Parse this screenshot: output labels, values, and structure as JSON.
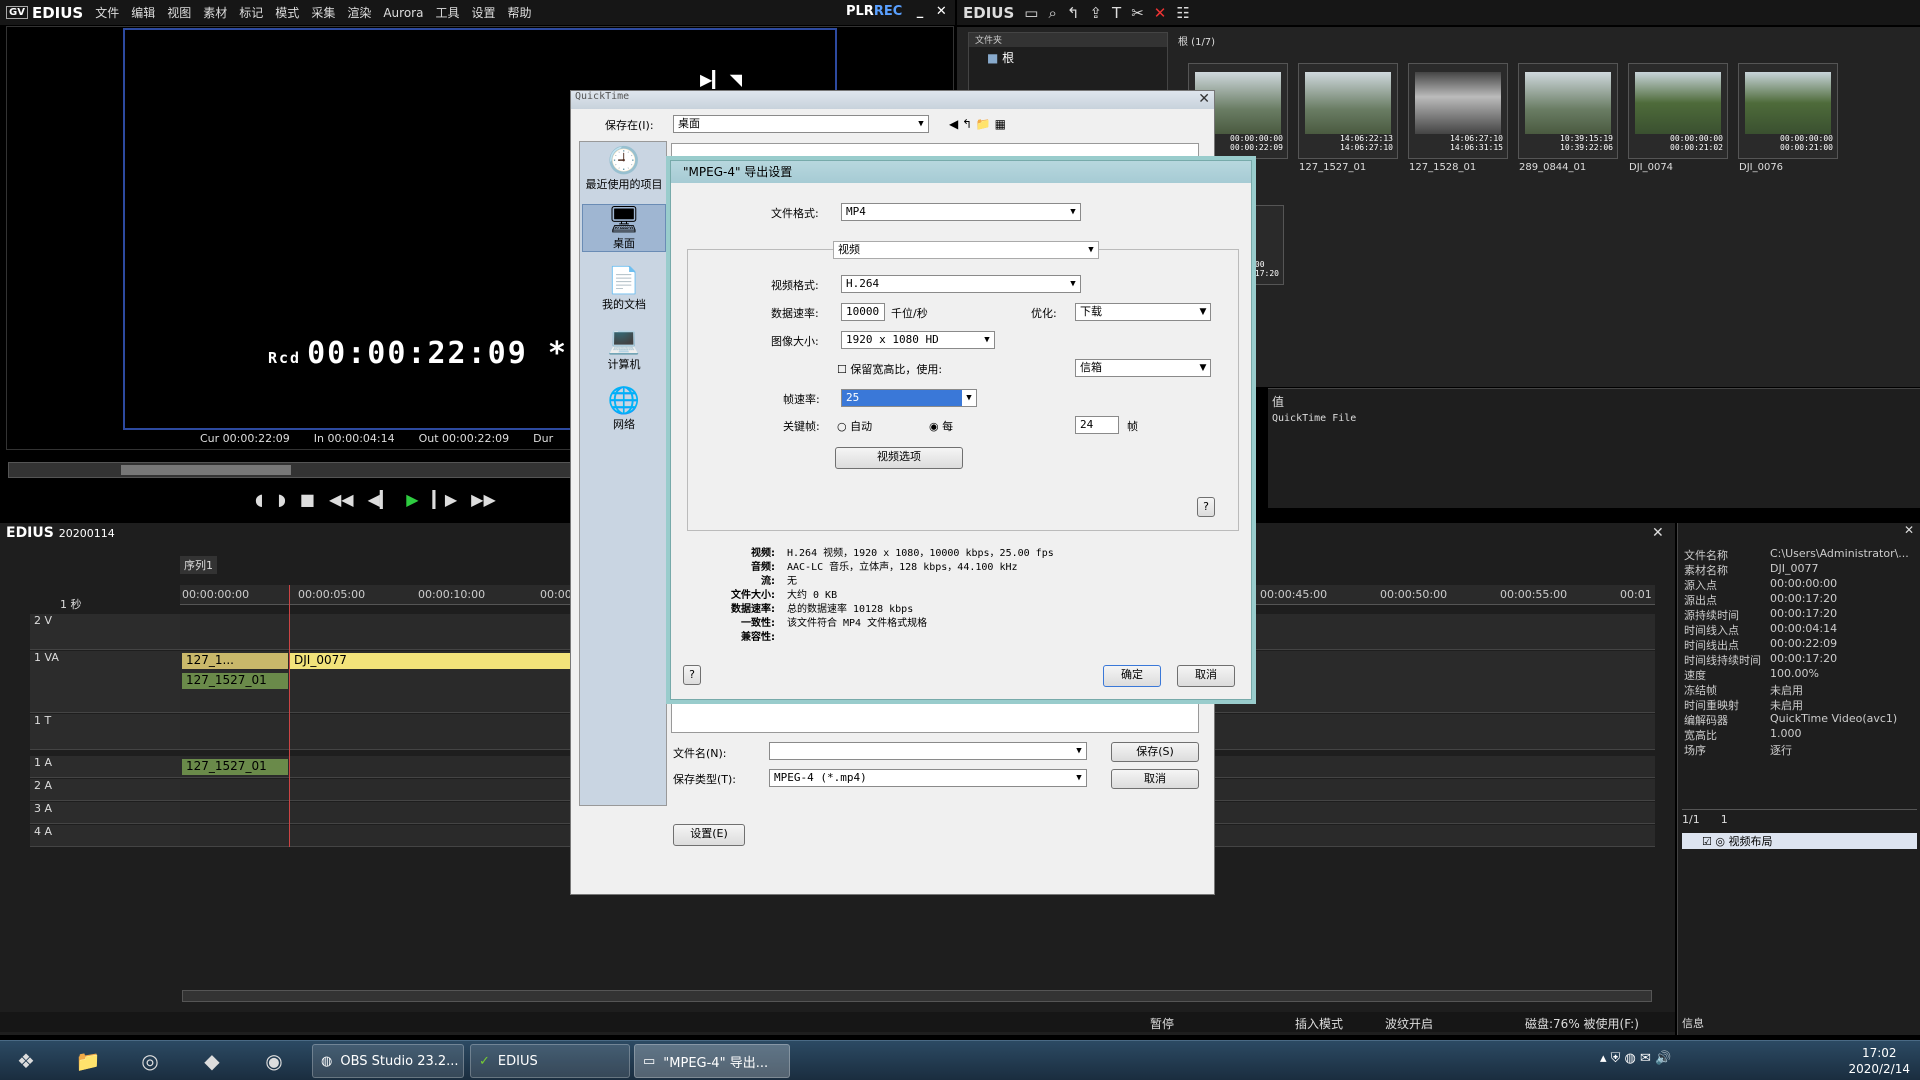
{
  "app": {
    "name": "EDIUS",
    "menu": [
      "文件",
      "编辑",
      "视图",
      "素材",
      "标记",
      "模式",
      "采集",
      "渲染",
      "Aurora",
      "工具",
      "设置",
      "帮助"
    ],
    "plr": "PLR",
    "rec": "REC"
  },
  "player": {
    "rcd_label": "Rcd",
    "timecode": "00:00:22:09",
    "cur": "Cur 00:00:22:09",
    "in": "In 00:00:04:14",
    "out": "Out 00:00:22:09",
    "dur": "Dur"
  },
  "bin": {
    "title": "EDIUS",
    "folder_header": "文件夹",
    "root": "根",
    "root_count": "根 (1/7)",
    "clips": [
      {
        "name": "",
        "time": "00:00:00:00\n00:00:22:09"
      },
      {
        "name": "127_1527_01",
        "time": "14:06:22:13\n14:06:27:10"
      },
      {
        "name": "127_1528_01",
        "time": "14:06:27:10\n14:06:31:15"
      },
      {
        "name": "289_0844_01",
        "time": "10:39:15:19\n10:39:22:06"
      },
      {
        "name": "DJI_0074",
        "time": "00:00:00:00\n00:00:21:02"
      },
      {
        "name": "DJI_0076",
        "time": "00:00:00:00\n00:00:21:00"
      }
    ],
    "extra_thumb_time": "00:00:00\n00:00:17:20",
    "prop_value_header": "值",
    "prop_value": "QuickTime File"
  },
  "timeline": {
    "title": "EDIUS",
    "project": "20200114",
    "sequence": "序列1",
    "scale": "1 秒",
    "ruler": [
      "00:00:00:00",
      "00:00:05:00",
      "00:00:10:00",
      "00:00",
      "00:00:45:00",
      "00:00:50:00",
      "00:00:55:00",
      "00:01"
    ],
    "tracks": [
      "2 V",
      "1 VA",
      "1 T",
      "1 A",
      "2 A",
      "3 A",
      "4 A"
    ],
    "clips": {
      "va_a": "127_1...",
      "va_b": "DJI_0077",
      "va_audio": "127_1527_01",
      "a1": "127_1527_01"
    }
  },
  "info": {
    "rows": [
      [
        "文件名称",
        "C:\\Users\\Administrator\\..."
      ],
      [
        "素材名称",
        "DJI_0077"
      ],
      [
        "源入点",
        "00:00:00:00"
      ],
      [
        "源出点",
        "00:00:17:20"
      ],
      [
        "源持续时间",
        "00:00:17:20"
      ],
      [
        "时间线入点",
        "00:00:04:14"
      ],
      [
        "时间线出点",
        "00:00:22:09"
      ],
      [
        "时间线持续时间",
        "00:00:17:20"
      ],
      [
        "速度",
        "100.00%"
      ],
      [
        "冻结帧",
        "未启用"
      ],
      [
        "时间重映射",
        "未启用"
      ],
      [
        "编解码器",
        "QuickTime Video(avc1)"
      ],
      [
        "宽高比",
        "1.000"
      ],
      [
        "场序",
        "逐行"
      ]
    ],
    "page": "1/1",
    "count": "1",
    "layout_item": "视频布局",
    "footer": "信息"
  },
  "status": {
    "pause": "暂停",
    "insert": "插入模式",
    "ripple": "波纹开启",
    "disk": "磁盘:76% 被使用(F:)"
  },
  "quicktime": {
    "title": "QuickTime",
    "save_in_label": "保存在(I):",
    "save_in_value": "桌面",
    "places": [
      "最近使用的项目",
      "桌面",
      "我的文档",
      "计算机",
      "网络"
    ],
    "filename_label": "文件名(N):",
    "filename_value": "",
    "filetype_label": "保存类型(T):",
    "filetype_value": "MPEG-4 (*.mp4)",
    "save_btn": "保存(S)",
    "cancel_btn": "取消",
    "settings_btn": "设置(E)"
  },
  "mpeg4": {
    "title": "\"MPEG-4\" 导出设置",
    "file_format_label": "文件格式:",
    "file_format_value": "MP4",
    "section": "视频",
    "video_format_label": "视频格式:",
    "video_format_value": "H.264",
    "data_rate_label": "数据速率:",
    "data_rate_value": "10000",
    "data_rate_unit": "千位/秒",
    "optimize_label": "优化:",
    "optimize_value": "下载",
    "image_size_label": "图像大小:",
    "image_size_value": "1920 x 1080 HD",
    "keep_aspect_label": "保留宽高比，使用:",
    "letterbox_value": "信箱",
    "frame_rate_label": "帧速率:",
    "frame_rate_value": "25",
    "keyframe_label": "关键帧:",
    "auto_label": "自动",
    "every_label": "每",
    "every_value": "24",
    "frames_unit": "帧",
    "video_options_btn": "视频选项",
    "help": "?",
    "summary": [
      [
        "视频:",
        "H.264 视频，1920 x 1080，10000 kbps，25.00 fps"
      ],
      [
        "音频:",
        "AAC-LC 音乐，立体声，128 kbps，44.100 kHz"
      ],
      [
        "流:",
        "无"
      ],
      [
        "文件大小:",
        "大约 0 KB"
      ],
      [
        "数据速率:",
        "总的数据速率 10128 kbps"
      ],
      [
        "一致性:",
        "该文件符合 MP4 文件格式规格"
      ],
      [
        "兼容性:",
        ""
      ]
    ],
    "ok_btn": "确定",
    "cancel_btn": "取消"
  },
  "taskbar": {
    "items": [
      "OBS Studio 23.2...",
      "EDIUS",
      "\"MPEG-4\" 导出..."
    ],
    "time": "17:02",
    "date": "2020/2/14"
  }
}
